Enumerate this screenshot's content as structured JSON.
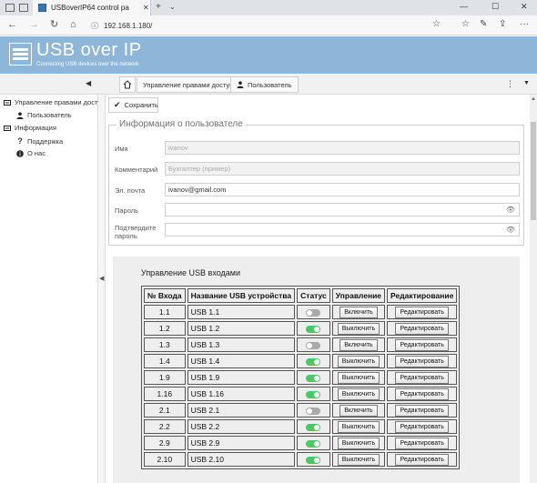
{
  "browser": {
    "tab_title": "USBoverIP64 control pa",
    "url": "192.168.1.180/"
  },
  "header": {
    "brand": "USB over IP",
    "tagline": "Connecting USB devices over the network"
  },
  "toolbar": {
    "tabs": [
      {
        "label": "Управление правами доступа"
      },
      {
        "label": "Пользователь"
      }
    ]
  },
  "sidebar": {
    "items": [
      {
        "label": "Управление правами досту"
      },
      {
        "label": "Пользователь"
      },
      {
        "label": "Информация"
      },
      {
        "label": "Поддержка"
      },
      {
        "label": "О нас"
      }
    ]
  },
  "actions": {
    "save_label": "Сохранить"
  },
  "user_info": {
    "legend": "Информация о пользователе",
    "fields": [
      {
        "label": "Имя",
        "value": "ivanov"
      },
      {
        "label": "Комментарий",
        "value": "Бухгалтер  (пример)"
      },
      {
        "label": "Эл. почта",
        "value": "ivanov@gmail.com"
      },
      {
        "label": "Пароль",
        "value": ""
      },
      {
        "label": "Подтвердите пароль",
        "value": ""
      }
    ]
  },
  "usb": {
    "title": "Управление USB входами",
    "columns": [
      "№ Входа",
      "Название USB устройства",
      "Статус",
      "Управление",
      "Редактирование"
    ],
    "rows": [
      {
        "port": "1.1",
        "name": "USB 1.1",
        "on": false,
        "action": "Включить",
        "edit": "Редактировать"
      },
      {
        "port": "1.2",
        "name": "USB 1.2",
        "on": true,
        "action": "Выключить",
        "edit": "Редактировать"
      },
      {
        "port": "1.3",
        "name": "USB 1.3",
        "on": false,
        "action": "Включить",
        "edit": "Редактировать"
      },
      {
        "port": "1.4",
        "name": "USB 1.4",
        "on": true,
        "action": "Выключить",
        "edit": "Редактировать"
      },
      {
        "port": "1.9",
        "name": "USB 1.9",
        "on": true,
        "action": "Выключить",
        "edit": "Редактировать"
      },
      {
        "port": "1.16",
        "name": "USB 1.16",
        "on": true,
        "action": "Выключить",
        "edit": "Редактировать"
      },
      {
        "port": "2.1",
        "name": "USB 2.1",
        "on": false,
        "action": "Включить",
        "edit": "Редактировать"
      },
      {
        "port": "2.2",
        "name": "USB 2.2",
        "on": true,
        "action": "Выключить",
        "edit": "Редактировать"
      },
      {
        "port": "2.9",
        "name": "USB 2.9",
        "on": true,
        "action": "Выключить",
        "edit": "Редактировать"
      },
      {
        "port": "2.10",
        "name": "USB 2.10",
        "on": true,
        "action": "Выключить",
        "edit": "Редактировать"
      }
    ]
  },
  "colors": {
    "header_bg": "#8eb6d9",
    "toggle_on": "#4bc865",
    "toggle_off": "#a9a9a9"
  }
}
